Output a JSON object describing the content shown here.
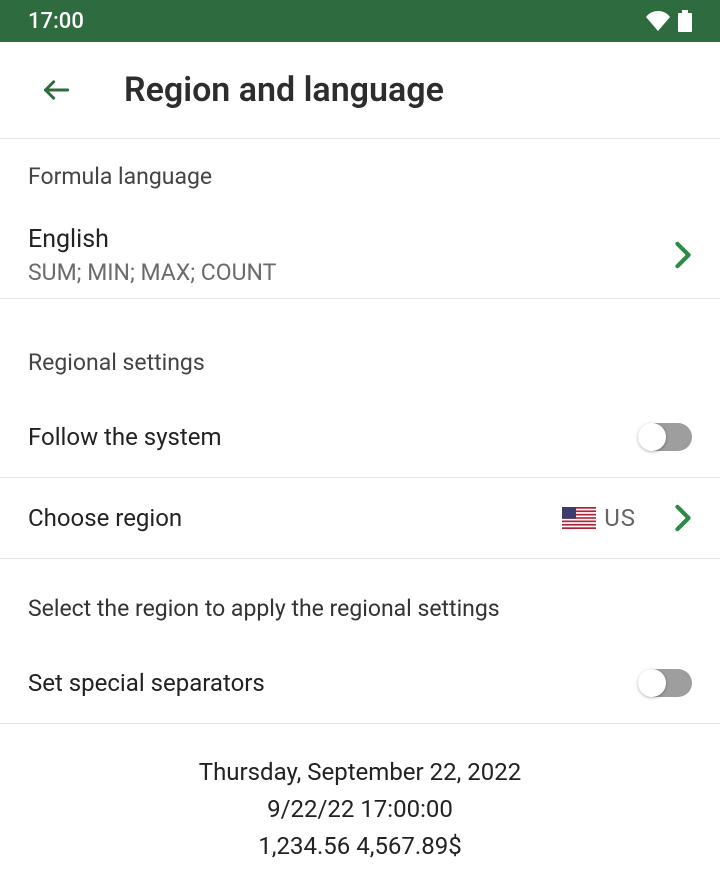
{
  "statusBar": {
    "time": "17:00"
  },
  "appBar": {
    "title": "Region and language"
  },
  "formula": {
    "header": "Formula language",
    "language": "English",
    "examples": "SUM; MIN; MAX; COUNT"
  },
  "regional": {
    "header": "Regional settings",
    "followSystem": "Follow the system",
    "chooseRegion": "Choose region",
    "regionCode": "US",
    "description": "Select the region to apply the regional settings",
    "setSeparators": "Set special separators"
  },
  "samples": {
    "dateLong": "Thursday, September 22, 2022",
    "dateTime": "9/22/22 17:00:00",
    "numbers": "1,234.56 4,567.89$"
  }
}
